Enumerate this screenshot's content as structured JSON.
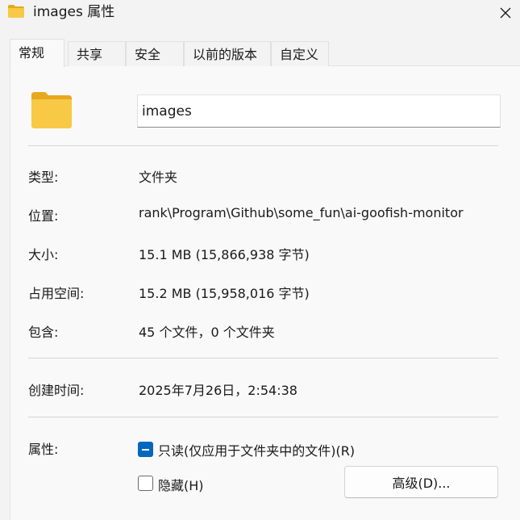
{
  "window": {
    "title": "images 属性",
    "icon": "folder-icon",
    "close_icon": "close-icon"
  },
  "tabs": [
    {
      "label": "常规",
      "active": true
    },
    {
      "label": "共享",
      "active": false
    },
    {
      "label": "安全",
      "active": false
    },
    {
      "label": "以前的版本",
      "active": false
    },
    {
      "label": "自定义",
      "active": false
    }
  ],
  "general": {
    "folder_icon": "folder-icon",
    "name_value": "images",
    "type_label": "类型:",
    "type_value": "文件夹",
    "location_label": "位置:",
    "location_value": "rank\\Program\\Github\\some_fun\\ai-goofish-monitor",
    "size_label": "大小:",
    "size_value": "15.1 MB (15,866,938 字节)",
    "disk_size_label": "占用空间:",
    "disk_size_value": "15.2 MB (15,958,016 字节)",
    "contains_label": "包含:",
    "contains_value": "45 个文件，0 个文件夹",
    "created_label": "创建时间:",
    "created_value": "2025年7月26日，2:54:38",
    "attributes_label": "属性:",
    "readonly_label": "只读(仅应用于文件夹中的文件)(R)",
    "readonly_state": "indeterminate",
    "hidden_label": "隐藏(H)",
    "hidden_state": "unchecked",
    "advanced_button": "高级(D)..."
  },
  "colors": {
    "accent": "#0067c0",
    "folder_yellow": "#f8c945",
    "folder_dark": "#e6a91e"
  }
}
